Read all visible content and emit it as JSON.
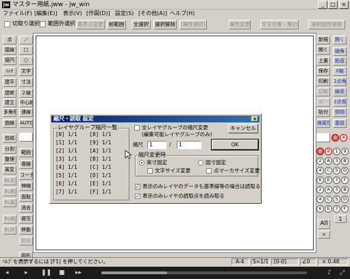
{
  "window": {
    "icon_label": "jw",
    "title": "マスター用紙.jww - jw_win",
    "minimize": "_",
    "maximize": "□",
    "close": "×"
  },
  "menu": [
    "ファイル(F)",
    "[編集(E)]",
    "表示(V)",
    "[作図(D)]",
    "設定(S)",
    "[その他(A)]",
    "ヘルプ(H)"
  ],
  "toolbar": {
    "cut_select_label": "切取り選択",
    "outside_select_label": "範囲外選択",
    "buttons": [
      "基準点変更",
      "前範囲",
      "全選択",
      "選択解除",
      "(属性選択)",
      "属性変更",
      "文字位置・集計",
      "選択図形登録"
    ]
  },
  "left_tools": [
    [
      "点",
      "／"
    ],
    [
      "接線",
      "□"
    ],
    [
      "接円",
      "○"
    ],
    [
      "ﾊｯﾁ",
      "文字"
    ],
    [
      "建平",
      "寸法"
    ],
    [
      "建断",
      "２線"
    ],
    [
      "建立",
      "中心線"
    ],
    [
      "多角形",
      "連線"
    ],
    [
      "曲線",
      "AUTO"
    ],
    [
      "包絡",
      ""
    ],
    [
      "分割",
      "範囲"
    ],
    [
      "整理",
      "複線"
    ],
    [
      "属変",
      "コーナー"
    ],
    [
      "BL化",
      "伸縮"
    ],
    [
      "BL解",
      "面取"
    ],
    [
      "BL属",
      "消去"
    ],
    [
      "BL編",
      "複写"
    ],
    [
      "BL終",
      "移動"
    ],
    [
      "",
      "戻る"
    ],
    [
      "",
      "図形"
    ]
  ],
  "right_tools": [
    [
      "新規",
      "開く"
    ],
    [
      "開く",
      "線角"
    ],
    [
      "上書",
      "鉛直"
    ],
    [
      "保存",
      "X軸"
    ],
    [
      "印刷",
      "2点角"
    ],
    [
      "切取",
      "線長"
    ],
    [
      "ｺﾋﾟｰ",
      "2点長"
    ],
    [
      "貼付",
      "間隔"
    ],
    [
      "線属性",
      "基設"
    ]
  ],
  "layer_groups": [
    "0",
    "1",
    "2",
    "3",
    "4",
    "5",
    "6",
    "7",
    "8",
    "9",
    "A",
    "B",
    "C",
    "D",
    "E",
    "F"
  ],
  "layers": [
    "0",
    "1",
    "2",
    "3",
    "4",
    "5",
    "6",
    "7",
    "8",
    "9",
    "A",
    "B",
    "C",
    "D",
    "E",
    "F"
  ],
  "all_label": "All",
  "x_label": "×",
  "dialog": {
    "title": "縮尺・読取 設定",
    "close": "×",
    "list_title": "レイヤグループ縮尺一覧",
    "list_rows": [
      [
        "[0]",
        "1/1",
        "[8]",
        "1/1"
      ],
      [
        "[1]",
        "1/1",
        "[9]",
        "1/1"
      ],
      [
        "[2]",
        "1/1",
        "[A]",
        "1/1"
      ],
      [
        "[3]",
        "1/1",
        "[B]",
        "1/1"
      ],
      [
        "[4]",
        "1/1",
        "[C]",
        "1/1"
      ],
      [
        "[5]",
        "1/1",
        "[D]",
        "1/1"
      ],
      [
        "[6]",
        "1/1",
        "[E]",
        "1/1"
      ],
      [
        "[7]",
        "1/1",
        "[F]",
        "1/1"
      ]
    ],
    "all_layers_label": "全レイヤグループの縮尺変更",
    "all_layers_sub": "(編集可能レイヤグループのみ)",
    "cancel_label": "キャンセル",
    "ok_label": "OK",
    "scale_label": "縮尺",
    "scale_num": "1",
    "scale_den": "1",
    "change_group_title": "縮尺変更時",
    "real_size_label": "実寸固定",
    "drawing_size_label": "図寸固定",
    "text_size_label": "文字サイズ変更",
    "point_marker_label": "点マーカサイズ変更",
    "opt1": "表示のみレイヤのデータも基準線等の場合は読取る",
    "opt2": "表示のみレイヤの読取点を読み取る"
  },
  "status": {
    "help": "ﾍﾙﾌﾟを表示するには [F1] を押してください。",
    "paper": "A-4",
    "scale": "S=1/1",
    "layer": "[0-0]",
    "angle": "∠0",
    "zoom": "× 0.48"
  },
  "taskbar": {
    "progress": 0.32
  }
}
